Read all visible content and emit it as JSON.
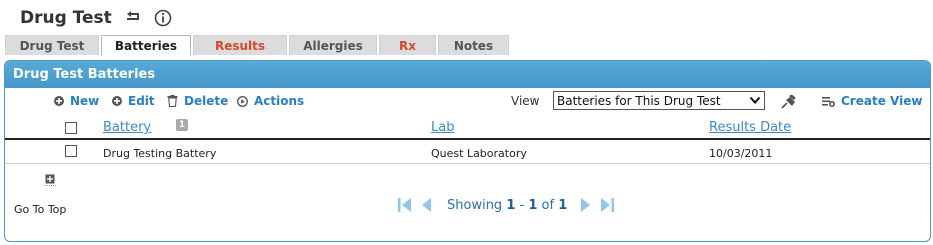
{
  "header": {
    "title": "Drug Test",
    "back_icon": "return-arrow-icon",
    "info_icon": "info-icon"
  },
  "tabs": [
    {
      "label": "Drug Test",
      "active": false,
      "color": "#555555"
    },
    {
      "label": "Batteries",
      "active": true,
      "color": "#222222"
    },
    {
      "label": "Results",
      "active": false,
      "color": "#d9482a"
    },
    {
      "label": "Allergies",
      "active": false,
      "color": "#555555"
    },
    {
      "label": "Rx",
      "active": false,
      "color": "#d9482a"
    },
    {
      "label": "Notes",
      "active": false,
      "color": "#555555"
    }
  ],
  "panel": {
    "title": "Drug Test Batteries",
    "header_color": "#4b9fd0"
  },
  "toolbar": {
    "new_label": "New",
    "edit_label": "Edit",
    "delete_label": "Delete",
    "actions_label": "Actions",
    "view_label": "View",
    "view_selected": "Batteries for This Drug Test",
    "create_view_label": "Create View"
  },
  "grid": {
    "columns": [
      {
        "label": "Battery",
        "sort_badge": "1"
      },
      {
        "label": "Lab"
      },
      {
        "label": "Results Date"
      }
    ],
    "rows": [
      {
        "battery": "Drug Testing Battery",
        "lab": "Quest Laboratory",
        "results_date": "10/03/2011"
      }
    ]
  },
  "footer": {
    "goto_top": "Go To Top",
    "pager_prefix": "Showing",
    "pager_from": "1",
    "pager_sep": "-",
    "pager_to": "1",
    "pager_of": "of",
    "pager_total": "1"
  },
  "colors": {
    "accent": "#2a7fc0",
    "link": "#3b8ac4",
    "alert": "#d9482a"
  }
}
